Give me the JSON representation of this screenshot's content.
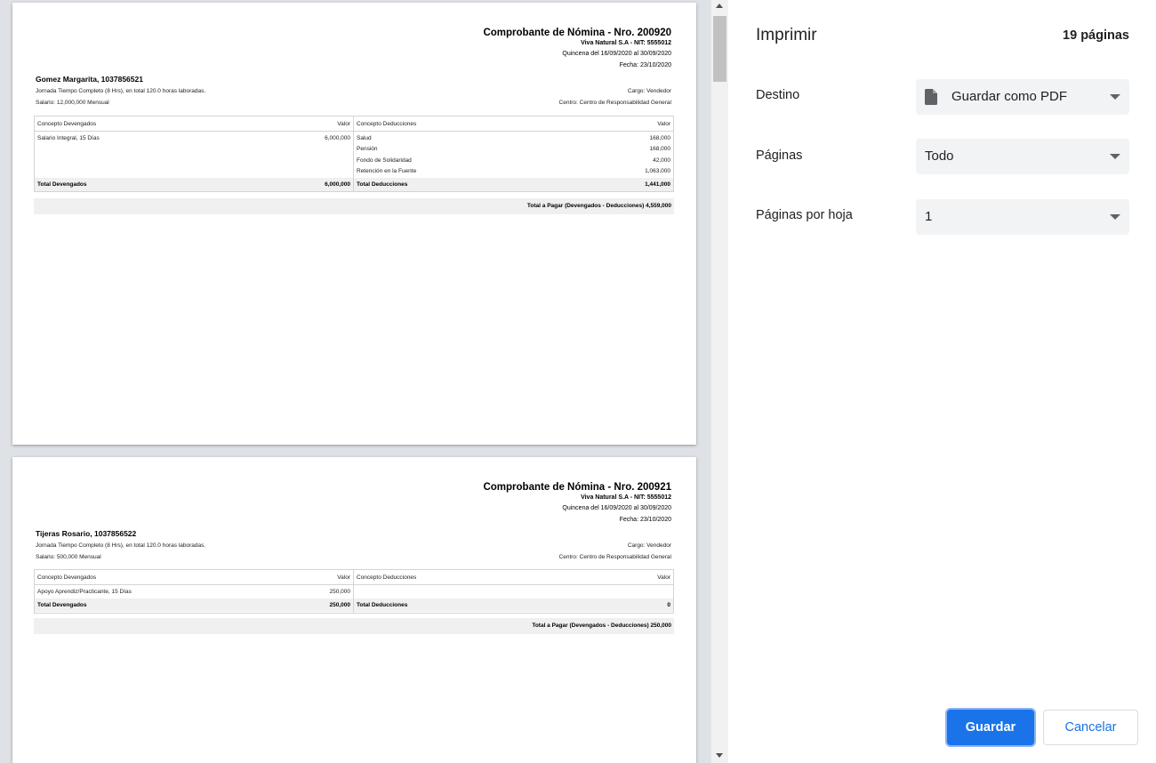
{
  "settings": {
    "title": "Imprimir",
    "page_count": "19 páginas",
    "destination_label": "Destino",
    "destination_value": "Guardar como PDF",
    "pages_label": "Páginas",
    "pages_value": "Todo",
    "pages_per_sheet_label": "Páginas por hoja",
    "pages_per_sheet_value": "1",
    "save_label": "Guardar",
    "cancel_label": "Cancelar"
  },
  "pages": [
    {
      "title": "Comprobante de Nómina - Nro. 200920",
      "company": "Viva Natural S.A - NIT: 5555012",
      "period": "Quincena del 16/09/2020 al 30/09/2020",
      "date": "Fecha: 23/10/2020",
      "employee": "Gomez Margarita, 1037856521",
      "schedule": "Jornada Tiempo Completo (8 Hrs), en total 120.0 horas laboradas.",
      "salary": "Salario: 12,000,000 Mensual",
      "position": "Cargo: Vendedor",
      "center": "Centro: Centro de Responsabilidad General",
      "col_earn": "Concepto Devengados",
      "col_value": "Valor",
      "col_deduct": "Concepto Deducciones",
      "earnings": [
        {
          "concept": "Salario Integral, 15 Días",
          "value": "6,000,000"
        }
      ],
      "deductions": [
        {
          "concept": "Salud",
          "value": "168,000"
        },
        {
          "concept": "Pensión",
          "value": "168,000"
        },
        {
          "concept": "Fondo de Solidaridad",
          "value": "42,000"
        },
        {
          "concept": "Retención en la Fuente",
          "value": "1,063,000"
        }
      ],
      "total_earn_label": "Total Devengados",
      "total_earn": "6,000,000",
      "total_deduct_label": "Total Deducciones",
      "total_deduct": "1,441,000",
      "net_pay": "Total a Pagar (Devengados - Deducciones) 4,559,000"
    },
    {
      "title": "Comprobante de Nómina - Nro. 200921",
      "company": "Viva Natural S.A - NIT: 5555012",
      "period": "Quincena del 16/09/2020 al 30/09/2020",
      "date": "Fecha: 23/10/2020",
      "employee": "Tijeras Rosario, 1037856522",
      "schedule": "Jornada Tiempo Completo (8 Hrs), en total 120.0 horas laboradas.",
      "salary": "Salario: 500,000 Mensual",
      "position": "Cargo: Vendedor",
      "center": "Centro: Centro de Responsabilidad General",
      "col_earn": "Concepto Devengados",
      "col_value": "Valor",
      "col_deduct": "Concepto Deducciones",
      "earnings": [
        {
          "concept": "Apoyo Aprendiz/Practicante, 15 Días",
          "value": "250,000"
        }
      ],
      "deductions": [],
      "total_earn_label": "Total Devengados",
      "total_earn": "250,000",
      "total_deduct_label": "Total Deducciones",
      "total_deduct": "0",
      "net_pay": "Total a Pagar (Devengados - Deducciones) 250,000"
    }
  ]
}
